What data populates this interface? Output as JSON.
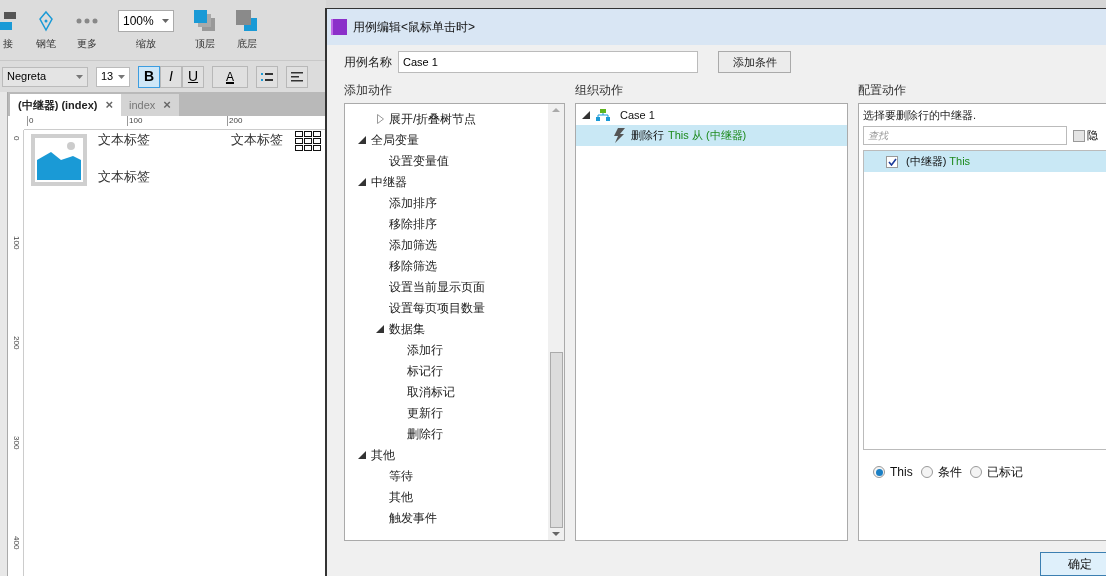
{
  "toolbar": {
    "items": [
      {
        "label": "接",
        "kind": "connect"
      },
      {
        "label": "钢笔",
        "kind": "pen"
      },
      {
        "label": "更多",
        "kind": "more"
      },
      {
        "label": "缩放",
        "kind": "zoom",
        "value": "100%"
      },
      {
        "label": "顶层",
        "kind": "front"
      },
      {
        "label": "底层",
        "kind": "back"
      }
    ]
  },
  "format_bar": {
    "font": "Negreta",
    "size": "13",
    "bold": {
      "label": "B",
      "on": true
    },
    "italic": {
      "label": "I",
      "on": false
    },
    "underline": {
      "label": "U",
      "on": false
    },
    "color": {
      "label": "A"
    }
  },
  "tabs": [
    {
      "label": "(中继器) (index)",
      "selected": true,
      "close": "×"
    },
    {
      "label": "index",
      "selected": false,
      "close": "×"
    }
  ],
  "ruler": {
    "horizontal": [
      "0",
      "100",
      "200"
    ],
    "vertical": [
      "0",
      "100",
      "200",
      "300",
      "400"
    ]
  },
  "canvas": {
    "labels": [
      "文本标签",
      "文本标签",
      "文本标签"
    ]
  },
  "dialog": {
    "title": "用例编辑<鼠标单击时>",
    "case_name_label": "用例名称",
    "case_name": "Case 1",
    "add_condition": "添加条件",
    "add_actions": {
      "heading": "添加动作",
      "continued": [
        {
          "label": "展开/折叠树节点",
          "expanded": false
        }
      ],
      "items": [
        {
          "label": "全局变量",
          "expanded": true,
          "children": [
            {
              "label": "设置变量值"
            }
          ]
        },
        {
          "label": "中继器",
          "expanded": true,
          "children": [
            {
              "label": "添加排序"
            },
            {
              "label": "移除排序"
            },
            {
              "label": "添加筛选"
            },
            {
              "label": "移除筛选"
            },
            {
              "label": "设置当前显示页面"
            },
            {
              "label": "设置每页项目数量"
            },
            {
              "label": "数据集",
              "expanded": true,
              "children": [
                {
                  "label": "添加行"
                },
                {
                  "label": "标记行"
                },
                {
                  "label": "取消标记"
                },
                {
                  "label": "更新行"
                },
                {
                  "label": "删除行"
                }
              ]
            }
          ]
        },
        {
          "label": "其他",
          "expanded": true,
          "children": [
            {
              "label": "等待"
            },
            {
              "label": "其他"
            },
            {
              "label": "触发事件"
            }
          ]
        }
      ]
    },
    "organize": {
      "heading": "组织动作",
      "case": {
        "label": "Case 1",
        "expanded": true,
        "actions": [
          {
            "action": "删除行",
            "target": "This 从 (中继器)",
            "selected": true
          }
        ]
      }
    },
    "configure": {
      "heading": "配置动作",
      "prompt": "选择要删除行的中继器.",
      "search_placeholder": "查找",
      "hide_checkbox": {
        "label": "隐",
        "checked": false
      },
      "repeaters": [
        {
          "name": "(中继器)",
          "target": "This",
          "checked": true,
          "selected": true
        }
      ],
      "radios": [
        {
          "label": "This",
          "selected": true
        },
        {
          "label": "条件",
          "selected": false
        },
        {
          "label": "已标记",
          "selected": false
        }
      ]
    },
    "ok": "确定"
  }
}
